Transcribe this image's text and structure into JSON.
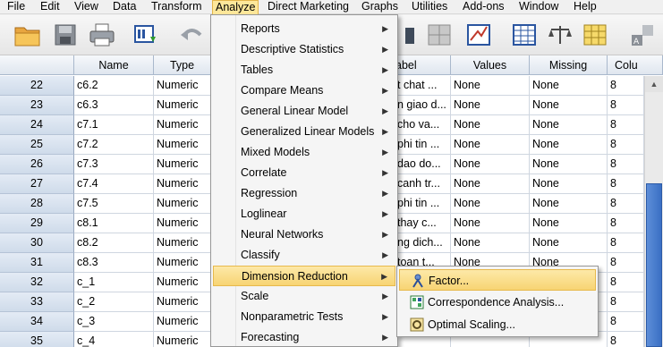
{
  "menubar": [
    "File",
    "Edit",
    "View",
    "Data",
    "Transform",
    "Analyze",
    "Direct Marketing",
    "Graphs",
    "Utilities",
    "Add-ons",
    "Window",
    "Help"
  ],
  "columns": [
    "Name",
    "Type",
    "abel",
    "Values",
    "Missing",
    "Colu"
  ],
  "rows": [
    {
      "num": "22",
      "name": "c6.2",
      "type": "Numeric",
      "label": "t chat ...",
      "values": "None",
      "missing": "None",
      "columns": "8"
    },
    {
      "num": "23",
      "name": "c6.3",
      "type": "Numeric",
      "label": "n giao d...",
      "values": "None",
      "missing": "None",
      "columns": "8"
    },
    {
      "num": "24",
      "name": "c7.1",
      "type": "Numeric",
      "label": "cho va...",
      "values": "None",
      "missing": "None",
      "columns": "8"
    },
    {
      "num": "25",
      "name": "c7.2",
      "type": "Numeric",
      "label": "phi tin ...",
      "values": "None",
      "missing": "None",
      "columns": "8"
    },
    {
      "num": "26",
      "name": "c7.3",
      "type": "Numeric",
      "label": "dao do...",
      "values": "None",
      "missing": "None",
      "columns": "8"
    },
    {
      "num": "27",
      "name": "c7.4",
      "type": "Numeric",
      "label": "canh tr...",
      "values": "None",
      "missing": "None",
      "columns": "8"
    },
    {
      "num": "28",
      "name": "c7.5",
      "type": "Numeric",
      "label": "phi tin ...",
      "values": "None",
      "missing": "None",
      "columns": "8"
    },
    {
      "num": "29",
      "name": "c8.1",
      "type": "Numeric",
      "label": "thay c...",
      "values": "None",
      "missing": "None",
      "columns": "8"
    },
    {
      "num": "30",
      "name": "c8.2",
      "type": "Numeric",
      "label": "ng dich...",
      "values": "None",
      "missing": "None",
      "columns": "8"
    },
    {
      "num": "31",
      "name": "c8.3",
      "type": "Numeric",
      "label": "toan t...",
      "values": "None",
      "missing": "None",
      "columns": "8"
    },
    {
      "num": "32",
      "name": "c_1",
      "type": "Numeric",
      "label": "",
      "values": "",
      "missing": "",
      "columns": "8"
    },
    {
      "num": "33",
      "name": "c_2",
      "type": "Numeric",
      "label": "",
      "values": "",
      "missing": "",
      "columns": "8"
    },
    {
      "num": "34",
      "name": "c_3",
      "type": "Numeric",
      "label": "",
      "values": "",
      "missing": "",
      "columns": "8"
    },
    {
      "num": "35",
      "name": "c_4",
      "type": "Numeric",
      "label": "",
      "values": "",
      "missing": "",
      "columns": "8"
    }
  ],
  "analyze_menu": [
    {
      "label": "Reports",
      "submenu": true
    },
    {
      "label": "Descriptive Statistics",
      "submenu": true
    },
    {
      "label": "Tables",
      "submenu": true
    },
    {
      "label": "Compare Means",
      "submenu": true
    },
    {
      "label": "General Linear Model",
      "submenu": true
    },
    {
      "label": "Generalized Linear Models",
      "submenu": true
    },
    {
      "label": "Mixed Models",
      "submenu": true
    },
    {
      "label": "Correlate",
      "submenu": true
    },
    {
      "label": "Regression",
      "submenu": true
    },
    {
      "label": "Loglinear",
      "submenu": true
    },
    {
      "label": "Neural Networks",
      "submenu": true
    },
    {
      "label": "Classify",
      "submenu": true
    },
    {
      "label": "Dimension Reduction",
      "submenu": true,
      "highlighted": true
    },
    {
      "label": "Scale",
      "submenu": true
    },
    {
      "label": "Nonparametric Tests",
      "submenu": true
    },
    {
      "label": "Forecasting",
      "submenu": true
    }
  ],
  "dimension_reduction_submenu": [
    {
      "label": "Factor...",
      "icon": "factor-icon",
      "highlighted": true
    },
    {
      "label": "Correspondence Analysis...",
      "icon": "correspondence-icon"
    },
    {
      "label": "Optimal Scaling...",
      "icon": "optimal-scaling-icon"
    }
  ],
  "colors": {
    "highlight": "#f7d473",
    "scroll_thumb": "#3a6fc4",
    "header": "#dfe6ef"
  }
}
